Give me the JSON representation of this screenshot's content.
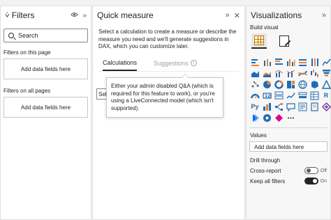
{
  "filters": {
    "title": "Filters",
    "search_placeholder": "Search",
    "on_this_page_label": "Filters on this page",
    "on_this_page_drop": "Add data fields here",
    "on_all_pages_label": "Filters on all pages",
    "on_all_pages_drop": "Add data fields here"
  },
  "quick_measure": {
    "title": "Quick measure",
    "description": "Select a calculation to create a measure or describe the measure you need and we'll generate suggestions in DAX, which you can customize later.",
    "tabs": [
      {
        "label": "Calculations",
        "active": true
      },
      {
        "label": "Suggestions",
        "active": false
      }
    ],
    "select_stub": "Sele",
    "tooltip": "Either your admin disabled Q&A (which is required for this feature to work), or you're using a LiveConnected model (which isn't supported)."
  },
  "visualizations": {
    "title": "Visualizations",
    "build_visual_label": "Build visual",
    "values_label": "Values",
    "values_drop": "Add data fields here",
    "drill_through_label": "Drill through",
    "cross_report_label": "Cross-report",
    "cross_report_state": "Off",
    "keep_all_filters_label": "Keep all filters",
    "keep_all_filters_state": "On",
    "icons": [
      "stacked-bar-icon",
      "stacked-column-icon",
      "clustered-bar-icon",
      "clustered-column-icon",
      "100-stacked-bar-icon",
      "100-stacked-column-icon",
      "line-chart-icon",
      "area-chart-icon",
      "stacked-area-icon",
      "line-column-icon",
      "line-clustered-icon",
      "ribbon-chart-icon",
      "waterfall-icon",
      "funnel-icon",
      "scatter-icon",
      "pie-icon",
      "donut-icon",
      "treemap-icon",
      "map-icon",
      "filled-map-icon",
      "azure-map-icon",
      "gauge-icon",
      "card-icon",
      "multi-row-card-icon",
      "kpi-icon",
      "slicer-icon",
      "table-icon",
      "r-visual-icon",
      "python-visual-icon",
      "key-influencers-icon",
      "decomposition-tree-icon",
      "qa-icon",
      "smart-narrative-icon",
      "paginated-report-icon",
      "power-apps-icon",
      "power-automate-icon",
      "arcgis-icon",
      "diamond-icon",
      "more-visuals-icon"
    ],
    "colors": {
      "accent": "#c07a00",
      "icon_blue": "#1f6cb4",
      "icon_orange": "#e8833a"
    }
  }
}
